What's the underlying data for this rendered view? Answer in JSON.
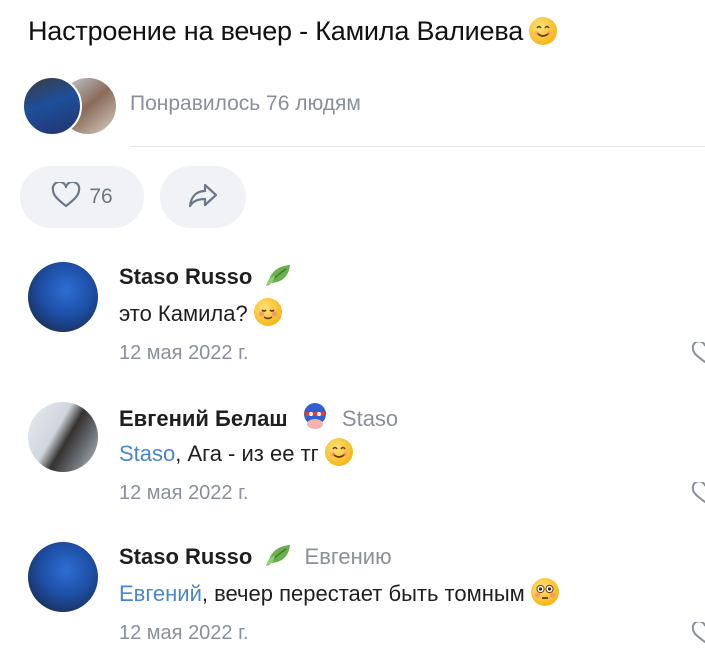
{
  "post": {
    "title": "Настроение на вечер - Камила Валиева",
    "title_emoji": "smiling-face-emoji"
  },
  "likes": {
    "summary": "Понравилось 76 людям",
    "avatars": [
      "liker-avatar-1",
      "liker-avatar-2"
    ]
  },
  "actions": {
    "like_count": "76",
    "like_icon": "heart-outline-icon",
    "share_icon": "share-arrow-icon"
  },
  "comments": [
    {
      "author": "Staso Russo",
      "badge": "leaf-icon",
      "reply_to": "",
      "mention": "",
      "text": "это Камила?",
      "emoji": "blushing-face-emoji",
      "date": "12 мая 2022 г."
    },
    {
      "author": "Евгений Белаш",
      "badge": "superhero-mask-icon",
      "reply_to": "Staso",
      "mention": "Staso",
      "text": ", Ага - из ее тг",
      "emoji": "smiling-face-emoji",
      "date": "12 мая 2022 г."
    },
    {
      "author": "Staso Russo",
      "badge": "leaf-icon",
      "reply_to": "Евгению",
      "mention": "Евгений",
      "text": ", вечер перестает быть томным",
      "emoji": "flushed-face-emoji",
      "date": "12 мая 2022 г."
    }
  ],
  "colors": {
    "accent_link": "#4a86c9",
    "muted_text": "#8a9099",
    "pill_bg": "#f0f2f5"
  }
}
